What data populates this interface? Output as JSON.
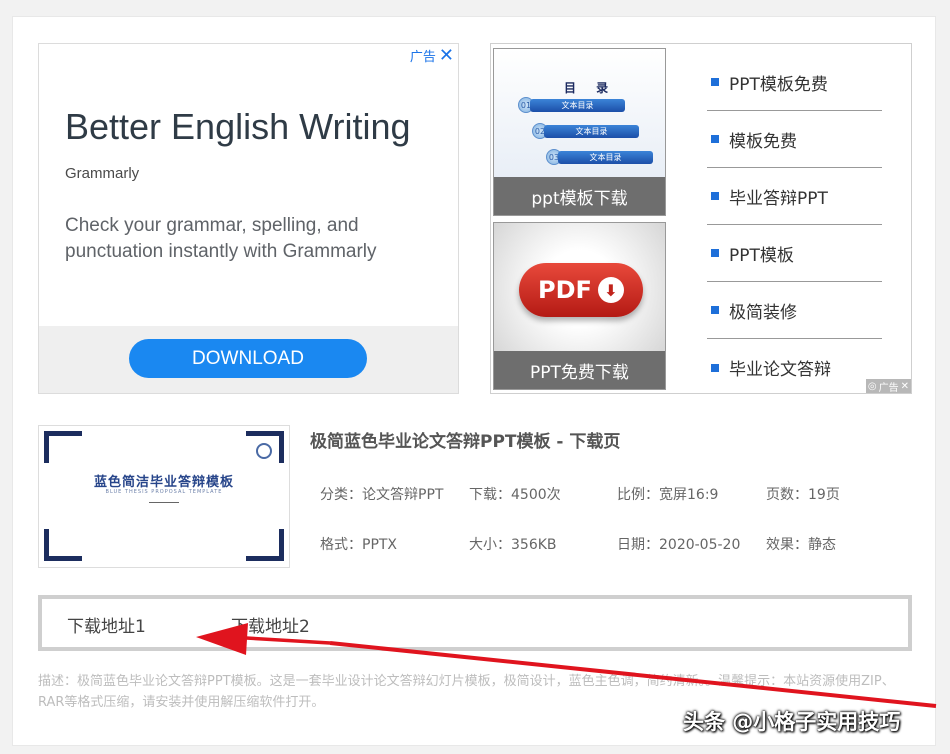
{
  "ad_left": {
    "ad_label": "广告",
    "title": "Better English Writing",
    "brand": "Grammarly",
    "description": "Check your grammar, spelling, and punctuation instantly with Grammarly",
    "button": "DOWNLOAD"
  },
  "ad_right": {
    "thumbs": [
      {
        "caption": "ppt模板下载",
        "toc_title": "目 录",
        "toc_items": [
          "文本目录",
          "文本目录",
          "文本目录"
        ],
        "toc_nums": [
          "01",
          "02",
          "03"
        ]
      },
      {
        "caption": "PPT免费下载",
        "pdf_text": "PDF"
      }
    ],
    "links": [
      "PPT模板免费",
      "模板免费",
      "毕业答辩PPT",
      "PPT模板",
      "极简装修",
      "毕业论文答辩"
    ],
    "ad_tag": "广告",
    "accent": "#1e6fd9"
  },
  "product": {
    "slide_title": "蓝色简洁毕业答辩模板",
    "slide_subtitle": "BLUE THESIS PROPOSAL TEMPLATE",
    "title": "极简蓝色毕业论文答辩PPT模板 - 下载页",
    "meta": {
      "category": "分类：论文答辩PPT",
      "downloads": "下载：4500次",
      "ratio": "比例：宽屏16:9",
      "pages": "页数：19页",
      "format": "格式：PPTX",
      "size": "大小：356KB",
      "date": "日期：2020-05-20",
      "effect": "效果：静态"
    }
  },
  "downloads": {
    "link1": "下载地址1",
    "link2": "下载地址2"
  },
  "description": "描述：极简蓝色毕业论文答辩PPT模板。这是一套毕业设计论文答辩幻灯片模板，极简设计，蓝色主色调，简约清新。。温馨提示：本站资源使用ZIP、RAR等格式压缩，请安装并使用解压缩软件打开。",
  "watermark": "头条 @小格子实用技巧",
  "annotation_color": "#e0141e"
}
